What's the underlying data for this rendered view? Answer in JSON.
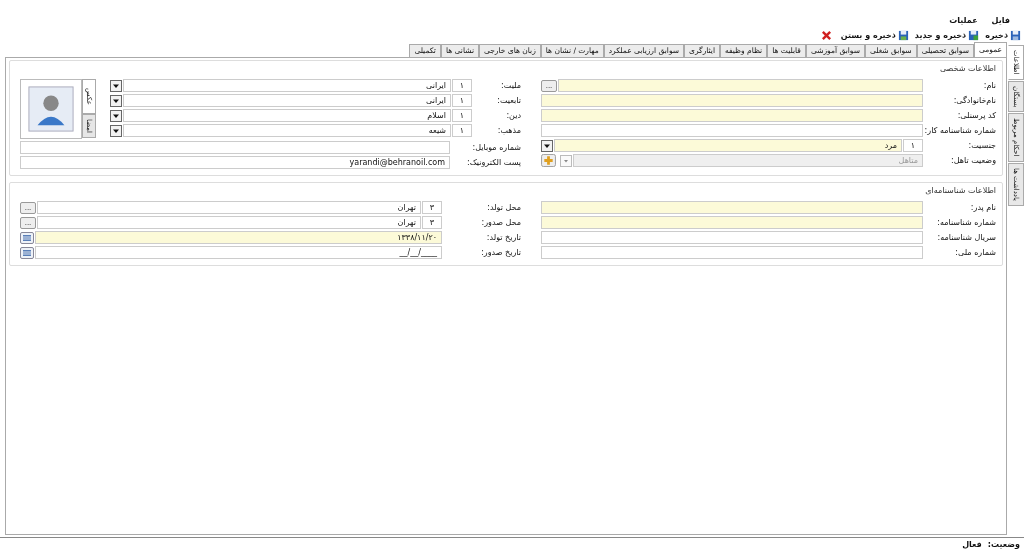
{
  "menu": [
    {
      "label": "فایل"
    },
    {
      "label": "عملیات"
    }
  ],
  "toolbar": [
    {
      "label": "ذخیره",
      "kind": "save"
    },
    {
      "label": "ذخیره و جدید",
      "kind": "save_new"
    },
    {
      "label": "ذخیره و بستن",
      "kind": "save_close"
    }
  ],
  "tabs": [
    {
      "label": "عمومی",
      "selected": true
    },
    {
      "label": "سوابق تحصیلی",
      "selected": false
    },
    {
      "label": "سوابق شغلی",
      "selected": false
    },
    {
      "label": "سوابق آموزشی",
      "selected": false
    },
    {
      "label": "قابلیت ها",
      "selected": false
    },
    {
      "label": "نظام وظیفه",
      "selected": false
    },
    {
      "label": "ایثارگری",
      "selected": false
    },
    {
      "label": "سوابق ارزیابی عملکرد",
      "selected": false
    },
    {
      "label": "مهارت / نشان ها",
      "selected": false
    },
    {
      "label": "زبان های خارجی",
      "selected": false
    },
    {
      "label": "نشانی ها",
      "selected": false
    },
    {
      "label": "تکمیلی",
      "selected": false
    }
  ],
  "side_tabs": [
    {
      "label": "اطلاعات",
      "selected": true
    },
    {
      "label": "بستگان",
      "selected": false
    },
    {
      "label": "احکام مربوط",
      "selected": false
    },
    {
      "label": "یادداشت ها",
      "selected": false
    }
  ],
  "personal": {
    "title": "اطلاعات شخصی",
    "right_fields": [
      {
        "label": "نام:",
        "kind": "lookup",
        "required": true,
        "button": "..."
      },
      {
        "label": "نام‌خانوادگی:",
        "kind": "text",
        "required": true
      },
      {
        "label": "کد پرسنلی:",
        "kind": "text",
        "required": true
      },
      {
        "label": "شماره شناسنامه کار:",
        "kind": "text",
        "required": false
      },
      {
        "label": "جنسیت:",
        "kind": "combo",
        "code": "۱",
        "value": "مرد",
        "required": true
      },
      {
        "label": "وضعیت تاهل:",
        "kind": "combo_add",
        "value": "متاهل",
        "disabled": true
      }
    ],
    "left_fields": [
      {
        "label": "ملیت:",
        "code": "۱",
        "value": "ایرانی"
      },
      {
        "label": "تابعیت:",
        "code": "۱",
        "value": "ایرانی"
      },
      {
        "label": "دین:",
        "code": "۱",
        "value": "اسلام"
      },
      {
        "label": "مذهب:",
        "code": "۱",
        "value": "شیعه"
      }
    ],
    "photo_tabs": [
      {
        "label": "عکس",
        "selected": true
      },
      {
        "label": "امضا",
        "selected": false
      }
    ],
    "wide_fields": [
      {
        "label": "شماره موبایل:"
      },
      {
        "label": "پست الکترونیک:",
        "value": "yarandi@behranoil.com"
      }
    ]
  },
  "identity": {
    "title": "اطلاعات شناسنامه‌ای",
    "right_fields": [
      {
        "label": "نام پدر:",
        "required": true
      },
      {
        "label": "شماره شناسنامه:",
        "required": true
      },
      {
        "label": "سریال شناسنامه:",
        "required": false
      },
      {
        "label": "شماره ملی:",
        "required": false
      }
    ],
    "left_fields": [
      {
        "label": "محل تولد:",
        "kind": "lookup",
        "code": "۳",
        "value": "تهران",
        "required": false,
        "button": "..."
      },
      {
        "label": "محل صدور:",
        "kind": "lookup",
        "code": "۳",
        "value": "تهران",
        "required": false,
        "button": "..."
      },
      {
        "label": "تاریخ تولد:",
        "kind": "date",
        "value": "۱۳۳۸/۱۱/۲۰",
        "required": true
      },
      {
        "label": "تاریخ صدور:",
        "kind": "date",
        "value": "__/__/____",
        "required": false
      }
    ]
  },
  "status": {
    "label": "وضعیت:",
    "value": "فعال"
  }
}
